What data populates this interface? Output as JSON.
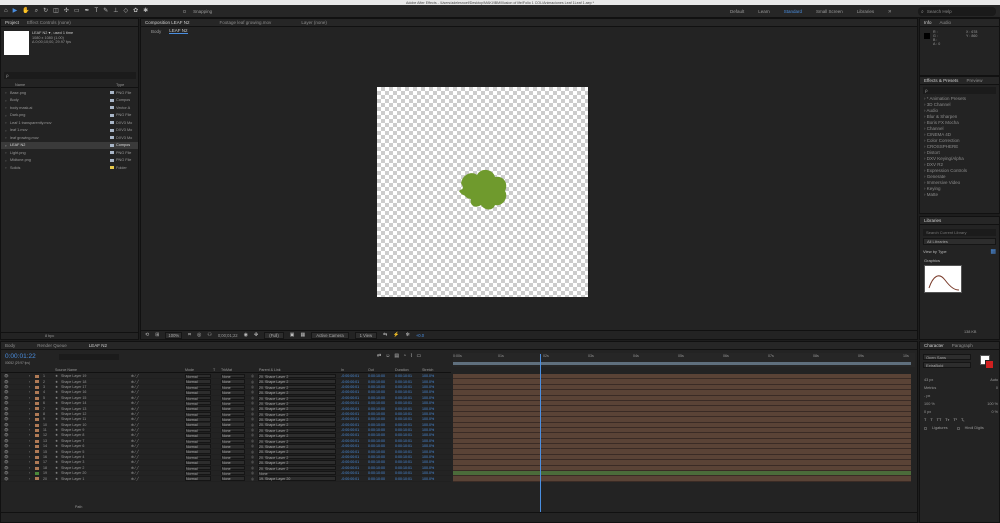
{
  "titlebar": {
    "text": "Adobe After Effects - /Users/adelesnoef/Desktop/MAKI/IBM/Illusion of life/Folio 1 COL/Animaciones Leaf 1Leaf 1.aep *"
  },
  "toolbar": {
    "snapping_label": "Snapping",
    "workspaces": [
      "Default",
      "Learn",
      "Standard",
      "Small Screen",
      "Libraries"
    ],
    "active_workspace": "Standard",
    "search_placeholder": "Search Help"
  },
  "project": {
    "tabs": [
      "Project",
      "Effect Controls (none)"
    ],
    "selected_name": "LEAF N2 ▾ , used 1 time",
    "selected_info1": "1080 x 1080 (1.00)",
    "selected_info2": "Δ 0;00;10;00, 29.97 fps",
    "search_placeholder": "ρ",
    "col_name": "Name",
    "col_type": "Type",
    "items": [
      {
        "name": "Base.png",
        "type": "PNG File",
        "color": "#a9b6c8"
      },
      {
        "name": "Body",
        "type": "Compos",
        "color": "#a9b6c8"
      },
      {
        "name": "body mask.ai",
        "type": "Vector A",
        "color": "#a9b6c8"
      },
      {
        "name": "Dark.png",
        "type": "PNG File",
        "color": "#a9b6c8"
      },
      {
        "name": "Leaf 1 transparently.mov",
        "type": "DXV3 Mo",
        "color": "#a9b6c8"
      },
      {
        "name": "leaf 1.mov",
        "type": "DXV3 Mo",
        "color": "#a9b6c8"
      },
      {
        "name": "leaf growing.mov",
        "type": "DXV3 Mo",
        "color": "#a9b6c8"
      },
      {
        "name": "LEAF N2",
        "type": "Compos",
        "color": "#a9b6c8"
      },
      {
        "name": "Light.png",
        "type": "PNG File",
        "color": "#a9b6c8"
      },
      {
        "name": "Midtone.png",
        "type": "PNG File",
        "color": "#a9b6c8"
      },
      {
        "name": "Solids",
        "type": "Folder",
        "color": "#e6c84a"
      }
    ],
    "selected_index": 7,
    "footer": "8 bpc"
  },
  "viewer": {
    "tab_label": "Composition LEAF N2",
    "footage_label": "Footage leaf growing.mov",
    "layer_label": "Layer (none)",
    "breadcrumbs": [
      "Body",
      "LEAF N2"
    ],
    "zoom": "100%",
    "timecode": "0;00;01;22",
    "resolution": "(Full)",
    "camera": "Active Camera",
    "views": "1 View",
    "exposure": "+0.0"
  },
  "info": {
    "tabs": [
      "Info",
      "Audio"
    ],
    "r": "R :",
    "g": "G :",
    "b": "B :",
    "a": "A : 0",
    "x": "X : 678",
    "y": "Y : 860"
  },
  "effects": {
    "tabs": [
      "Effects & Presets",
      "Preview"
    ],
    "search_placeholder": "ρ",
    "items": [
      "* Animation Presets",
      "3D Channel",
      "Audio",
      "Blur & Sharpen",
      "Boris FX Mocha",
      "Channel",
      "CINEMA 4D",
      "Color Correction",
      "CROSSPHERE",
      "Distort",
      "DXV Keying/Alpha",
      "DXV R2",
      "Expression Controls",
      "Generate",
      "Immersive Video",
      "Keying",
      "Matte"
    ]
  },
  "libraries": {
    "title": "Libraries",
    "search_placeholder": "Search Current Library",
    "library": "All Libraries",
    "view_by": "View by Type",
    "section": "Graphics",
    "size": "138 KB"
  },
  "timeline": {
    "tabs": [
      "Body",
      "Render Queue",
      "LEAF N2"
    ],
    "timecode": "0:00:01:22",
    "fps_info": "00052 (29.97 fps)",
    "columns": [
      "Source Name",
      "Mode",
      "T",
      "TrkMat",
      "Parent & Link",
      "In",
      "Out",
      "Duration",
      "Stretch"
    ],
    "ruler": [
      "0:00s",
      "01s",
      "02s",
      "03s",
      "04s",
      "05s",
      "06s",
      "07s",
      "08s",
      "09s",
      "10s"
    ],
    "layers": [
      {
        "n": "1",
        "name": "Shape Layer 19",
        "parent": "20. Shape Layer 2",
        "in": "-0:00:00:01",
        "out": "0:00:10:00",
        "dur": "0:00:10:01",
        "stretch": "100.0%"
      },
      {
        "n": "2",
        "name": "Shape Layer 18",
        "parent": "20. Shape Layer 2",
        "in": "-0:00:00:01",
        "out": "0:00:10:00",
        "dur": "0:00:10:01",
        "stretch": "100.0%"
      },
      {
        "n": "3",
        "name": "Shape Layer 17",
        "parent": "20. Shape Layer 2",
        "in": "-0:00:00:01",
        "out": "0:00:10:00",
        "dur": "0:00:10:01",
        "stretch": "100.0%"
      },
      {
        "n": "4",
        "name": "Shape Layer 16",
        "parent": "20. Shape Layer 2",
        "in": "-0:00:00:01",
        "out": "0:00:10:00",
        "dur": "0:00:10:01",
        "stretch": "100.0%"
      },
      {
        "n": "5",
        "name": "Shape Layer 15",
        "parent": "20. Shape Layer 2",
        "in": "-0:00:00:01",
        "out": "0:00:10:00",
        "dur": "0:00:10:01",
        "stretch": "100.0%"
      },
      {
        "n": "6",
        "name": "Shape Layer 14",
        "parent": "20. Shape Layer 2",
        "in": "-0:00:00:01",
        "out": "0:00:10:00",
        "dur": "0:00:10:01",
        "stretch": "100.0%"
      },
      {
        "n": "7",
        "name": "Shape Layer 13",
        "parent": "20. Shape Layer 2",
        "in": "-0:00:00:01",
        "out": "0:00:10:00",
        "dur": "0:00:10:01",
        "stretch": "100.0%"
      },
      {
        "n": "8",
        "name": "Shape Layer 12",
        "parent": "20. Shape Layer 2",
        "in": "-0:00:00:01",
        "out": "0:00:10:00",
        "dur": "0:00:10:01",
        "stretch": "100.0%"
      },
      {
        "n": "9",
        "name": "Shape Layer 11",
        "parent": "20. Shape Layer 2",
        "in": "-0:00:00:01",
        "out": "0:00:10:00",
        "dur": "0:00:10:01",
        "stretch": "100.0%"
      },
      {
        "n": "10",
        "name": "Shape Layer 10",
        "parent": "20. Shape Layer 2",
        "in": "-0:00:00:01",
        "out": "0:00:10:00",
        "dur": "0:00:10:01",
        "stretch": "100.0%"
      },
      {
        "n": "11",
        "name": "Shape Layer 9",
        "parent": "20. Shape Layer 2",
        "in": "-0:00:00:01",
        "out": "0:00:10:00",
        "dur": "0:00:10:01",
        "stretch": "100.0%"
      },
      {
        "n": "12",
        "name": "Shape Layer 8",
        "parent": "20. Shape Layer 2",
        "in": "-0:00:00:01",
        "out": "0:00:10:00",
        "dur": "0:00:10:01",
        "stretch": "100.0%"
      },
      {
        "n": "13",
        "name": "Shape Layer 7",
        "parent": "20. Shape Layer 2",
        "in": "-0:00:00:01",
        "out": "0:00:10:00",
        "dur": "0:00:10:01",
        "stretch": "100.0%"
      },
      {
        "n": "14",
        "name": "Shape Layer 6",
        "parent": "20. Shape Layer 2",
        "in": "-0:00:00:01",
        "out": "0:00:10:00",
        "dur": "0:00:10:01",
        "stretch": "100.0%"
      },
      {
        "n": "15",
        "name": "Shape Layer 5",
        "parent": "20. Shape Layer 2",
        "in": "-0:00:00:01",
        "out": "0:00:10:00",
        "dur": "0:00:10:01",
        "stretch": "100.0%"
      },
      {
        "n": "16",
        "name": "Shape Layer 4",
        "parent": "20. Shape Layer 2",
        "in": "-0:00:00:01",
        "out": "0:00:10:00",
        "dur": "0:00:10:01",
        "stretch": "100.0%"
      },
      {
        "n": "17",
        "name": "Shape Layer 3",
        "parent": "20. Shape Layer 2",
        "in": "-0:00:00:01",
        "out": "0:00:10:00",
        "dur": "0:00:10:01",
        "stretch": "100.0%"
      },
      {
        "n": "18",
        "name": "Shape Layer 2",
        "parent": "20. Shape Layer 2",
        "in": "-0:00:00:01",
        "out": "0:00:10:00",
        "dur": "0:00:10:01",
        "stretch": "100.0%"
      },
      {
        "n": "19",
        "name": "Shape Layer 20",
        "parent": "None",
        "in": "-0:00:00:01",
        "out": "0:00:10:00",
        "dur": "0:00:10:01",
        "stretch": "100.0%"
      },
      {
        "n": "20",
        "name": "Shape Layer 1",
        "parent": "19. Shape Layer 20",
        "in": "-0:00:00:01",
        "out": "0:00:10:00",
        "dur": "0:00:10:01",
        "stretch": "100.0%"
      }
    ],
    "mode_value": "Normal",
    "trkmat_value": "None",
    "path_label": "Path",
    "playhead_fraction": 0.19
  },
  "character": {
    "tabs": [
      "Character",
      "Paragraph"
    ],
    "font": "Open Sans",
    "style": "ExtraBold",
    "size": "43 px",
    "leading": "Auto",
    "kerning": "Metrics",
    "tracking": "0",
    "stroke": "- px",
    "vscale": "100 %",
    "hscale": "100 %",
    "baseline": "0 px",
    "tsume": "0 %",
    "ligatures": "Ligatures",
    "hindi": "Hindi Digits"
  },
  "colors": {
    "accent": "#4a8ee0",
    "leaf": "#6f9a2d",
    "track": "#5a4336"
  }
}
